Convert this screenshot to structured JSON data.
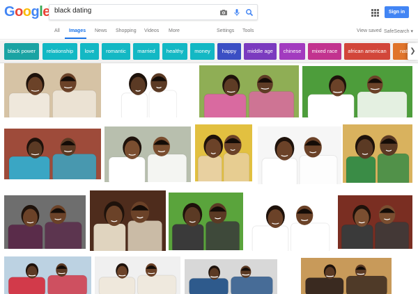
{
  "logo": {
    "letters": [
      "G",
      "o",
      "o",
      "g",
      "l",
      "e"
    ],
    "colors": [
      "#4285f4",
      "#ea4335",
      "#fbbc05",
      "#4285f4",
      "#34a853",
      "#ea4335"
    ]
  },
  "search": {
    "value": "black dating"
  },
  "signin_label": "Sign in",
  "nav": {
    "tabs": [
      "All",
      "Images",
      "News",
      "Shopping",
      "Videos",
      "More"
    ],
    "active_tab": "Images",
    "settings": "Settings",
    "tools": "Tools",
    "view_saved": "View saved",
    "safesearch": "SafeSearch ▾"
  },
  "chips": [
    {
      "label": "black power",
      "color": "#1aa3a3"
    },
    {
      "label": "relationship",
      "color": "#13b8c4"
    },
    {
      "label": "love",
      "color": "#13b8c4"
    },
    {
      "label": "romantic",
      "color": "#13b8c4"
    },
    {
      "label": "married",
      "color": "#13b8c4"
    },
    {
      "label": "healthy",
      "color": "#13b8c4"
    },
    {
      "label": "money",
      "color": "#13b8c4"
    },
    {
      "label": "happy",
      "color": "#3b4fc4"
    },
    {
      "label": "middle age",
      "color": "#7b3bbf"
    },
    {
      "label": "chinese",
      "color": "#a23bbf"
    },
    {
      "label": "mixed race",
      "color": "#c2338f"
    },
    {
      "label": "african american",
      "color": "#d2463a"
    },
    {
      "label": "native",
      "color": "#e0742b"
    }
  ],
  "images": [
    {
      "alt": "couple smiling cheek to cheek",
      "bg": "#d6c3a5",
      "skin": "#6b4228",
      "shirt": "#efe8dc"
    },
    {
      "alt": "couple embracing on white",
      "bg": "#ffffff",
      "skin": "#5b3a24",
      "shirt": "#ffffff"
    },
    {
      "alt": "couple in park",
      "bg": "#8fae55",
      "skin": "#5e3c25",
      "shirt": "#d96aa0"
    },
    {
      "alt": "couple lying on grass",
      "bg": "#4d9d3b",
      "skin": "#6b4228",
      "shirt": "#ffffff"
    },
    {
      "alt": "couple on couch",
      "bg": "#9e4b3a",
      "skin": "#5b3a24",
      "shirt": "#3aa6c4"
    },
    {
      "alt": "couple hugging outdoors",
      "bg": "#b8bfae",
      "skin": "#7a4e30",
      "shirt": "#ffffff"
    },
    {
      "alt": "couple in sunlight",
      "bg": "#e2c040",
      "skin": "#6b4228",
      "shirt": "#e8d0a0"
    },
    {
      "alt": "couple piggyback",
      "bg": "#f6f6f6",
      "skin": "#6b4228",
      "shirt": "#ffffff"
    },
    {
      "alt": "couple on bench",
      "bg": "#d9b25e",
      "skin": "#5b3a24",
      "shirt": "#3a8c46"
    },
    {
      "alt": "couple portrait",
      "bg": "#6e6e6e",
      "skin": "#6b4228",
      "shirt": "#5a2c4a"
    },
    {
      "alt": "couple in cafe",
      "bg": "#4e2c1c",
      "skin": "#6b4228",
      "shirt": "#e0d4bf"
    },
    {
      "alt": "couple on lawn",
      "bg": "#5aa43c",
      "skin": "#5b3a24",
      "shirt": "#3a3a3a"
    },
    {
      "alt": "couple laughing",
      "bg": "#ffffff",
      "skin": "#6b4228",
      "shirt": "#ffffff"
    },
    {
      "alt": "woman smiling",
      "bg": "#7a2e22",
      "skin": "#7a4e30",
      "shirt": "#3a3a3a"
    },
    {
      "alt": "couple at harbor",
      "bg": "#bcd2e2",
      "skin": "#5b3a24",
      "shirt": "#d23a4a"
    },
    {
      "alt": "couple thinking",
      "bg": "#f0f0f0",
      "skin": "#6b4228",
      "shirt": "#efe8dc"
    },
    {
      "alt": "couple standing",
      "bg": "#d8d8d8",
      "skin": "#5b3a24",
      "shirt": "#2e5a8c"
    },
    {
      "alt": "couple close up",
      "bg": "#c89a5a",
      "skin": "#5b3a24",
      "shirt": "#3a2a20"
    }
  ]
}
